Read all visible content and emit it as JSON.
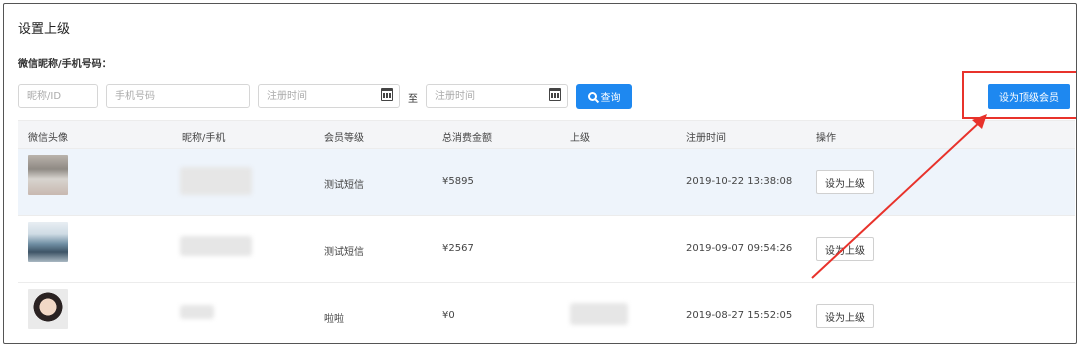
{
  "header": {
    "title": "设置上级",
    "filter_label": "微信昵称/手机号码："
  },
  "filters": {
    "nickname_placeholder": "昵称/ID",
    "phone_placeholder": "手机号码",
    "start_date_placeholder": "注册时间",
    "to_label": "至",
    "end_date_placeholder": "注册时间",
    "query_label": "查询"
  },
  "actions": {
    "set_top_label": "设为顶级会员"
  },
  "table": {
    "columns": [
      "微信头像",
      "昵称/手机",
      "会员等级",
      "总消费金额",
      "上级",
      "注册时间",
      "操作"
    ],
    "rows": [
      {
        "level": "测试短信",
        "amount": "¥5895",
        "parent": "",
        "registered": "2019-10-22 13:38:08",
        "action": "设为上级"
      },
      {
        "level": "测试短信",
        "amount": "¥2567",
        "parent": "",
        "registered": "2019-09-07 09:54:26",
        "action": "设为上级"
      },
      {
        "level": "啦啦",
        "amount": "¥0",
        "parent": "",
        "registered": "2019-08-27 15:52:05",
        "action": "设为上级"
      }
    ]
  },
  "colors": {
    "primary": "#1e88f0",
    "highlight": "#e8322b",
    "row_highlight": "#eef4fb"
  }
}
